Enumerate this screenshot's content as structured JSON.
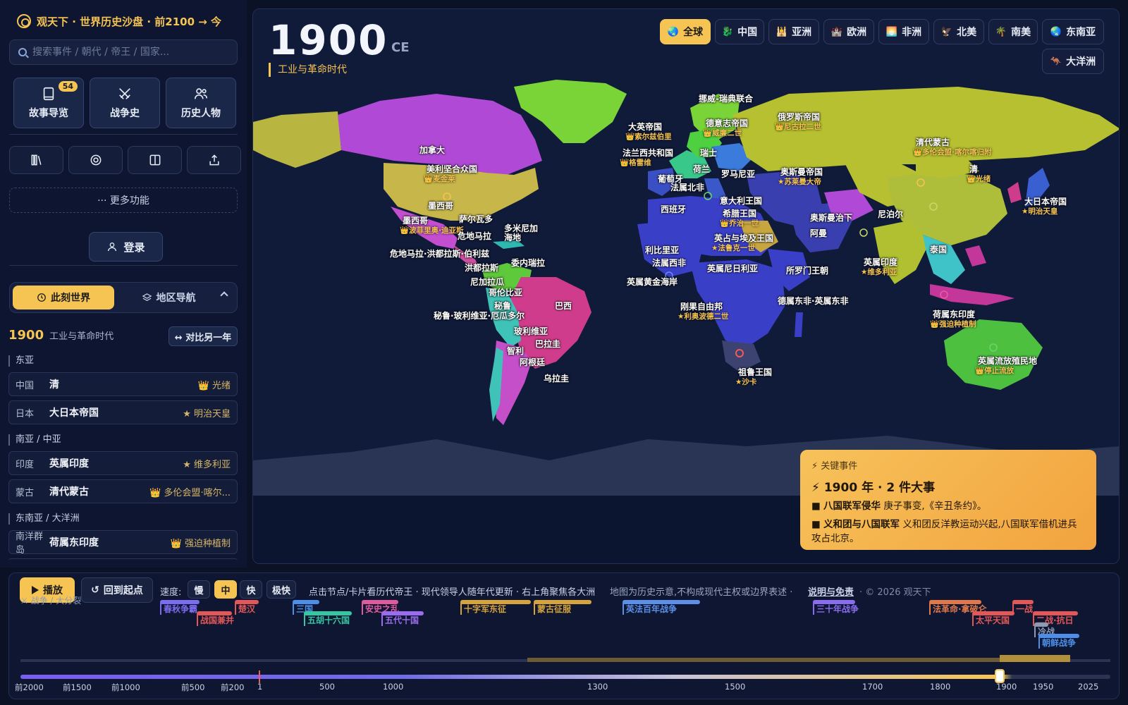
{
  "app": {
    "title": "观天下 · 世界历史沙盘 · 前2100 → 今",
    "search_placeholder": "搜索事件 / 朝代 / 帝王 / 国家..."
  },
  "nav": {
    "stories_label": "故事导览",
    "stories_badge": "54",
    "wars_label": "战争史",
    "people_label": "历史人物",
    "more_label": "··· 更多功能",
    "login_label": "登录"
  },
  "mode": {
    "now_label": "此刻世界",
    "region_label": "地区导航"
  },
  "current": {
    "year": "1900",
    "era": "工业与革命时代",
    "compare_label": "↔ 对比另一年",
    "big_year": "1900",
    "ce": "CE"
  },
  "regions_panel": [
    {
      "head": "东亚",
      "rows": [
        {
          "country": "中国",
          "state": "清",
          "ruler": "👑 光绪"
        },
        {
          "country": "日本",
          "state": "大日本帝国",
          "ruler": "★ 明治天皇"
        }
      ]
    },
    {
      "head": "南亚 / 中亚",
      "rows": [
        {
          "country": "印度",
          "state": "英属印度",
          "ruler": "★ 维多利亚"
        },
        {
          "country": "蒙古",
          "state": "清代蒙古",
          "ruler": "👑 多伦会盟·喀尔..."
        }
      ]
    },
    {
      "head": "东南亚 / 大洋洲",
      "rows": [
        {
          "country": "南洋群岛",
          "state": "荷属东印度",
          "ruler": "👑 强迫种植制"
        }
      ]
    }
  ],
  "region_buttons": [
    {
      "icon": "🌏",
      "label": "全球",
      "active": true
    },
    {
      "icon": "🐉",
      "label": "中国"
    },
    {
      "icon": "🕌",
      "label": "亚洲"
    },
    {
      "icon": "🏰",
      "label": "欧洲"
    },
    {
      "icon": "🌅",
      "label": "非洲"
    },
    {
      "icon": "🦅",
      "label": "北美"
    },
    {
      "icon": "🌴",
      "label": "南美"
    },
    {
      "icon": "🌏",
      "label": "东南亚"
    },
    {
      "icon": "🦘",
      "label": "大洋洲"
    }
  ],
  "map_labels": [
    {
      "t": "挪威-瑞典联合"
    },
    {
      "t": "大英帝国",
      "s": "👑索尔兹伯里"
    },
    {
      "t": "德意志帝国",
      "s": "👑威廉二世"
    },
    {
      "t": "俄罗斯帝国",
      "s": "👑尼古拉二世"
    },
    {
      "t": "清代蒙古",
      "s": "👑多伦会盟·喀尔喀归附"
    },
    {
      "t": "加拿大"
    },
    {
      "t": "法兰西共和国",
      "s": "👑格雷维"
    },
    {
      "t": "瑞士"
    },
    {
      "t": "荷兰"
    },
    {
      "t": "清",
      "s": "👑光绪"
    },
    {
      "t": "美利坚合众国",
      "s": "👑麦金莱"
    },
    {
      "t": "葡萄牙"
    },
    {
      "t": "罗马尼亚"
    },
    {
      "t": "奥斯曼帝国",
      "s": "★苏莱曼大帝"
    },
    {
      "t": "法属北非"
    },
    {
      "t": "意大利王国"
    },
    {
      "t": "大日本帝国",
      "s": "★明治天皇"
    },
    {
      "t": "墨西哥"
    },
    {
      "t": "西班牙"
    },
    {
      "t": "希腊王国",
      "s": "👑乔治一世"
    },
    {
      "t": "尼泊尔"
    },
    {
      "t": "奥斯曼治下"
    },
    {
      "t": "墨西哥",
      "s": "👑波菲里奥·迪亚斯"
    },
    {
      "t": "萨尔瓦多"
    },
    {
      "t": "多米尼加"
    },
    {
      "t": "海地"
    },
    {
      "t": "阿曼"
    },
    {
      "t": "危地马拉"
    },
    {
      "t": "英占与埃及王国",
      "s": "★法鲁克一世"
    },
    {
      "t": "利比里亚"
    },
    {
      "t": "泰国"
    },
    {
      "t": "危地马拉·洪都拉斯·伯利兹"
    },
    {
      "t": "英属印度",
      "s": "★维多利亚"
    },
    {
      "t": "委内瑞拉"
    },
    {
      "t": "法属西非"
    },
    {
      "t": "英属尼日利亚"
    },
    {
      "t": "所罗门王朝"
    },
    {
      "t": "洪都拉斯"
    },
    {
      "t": "尼加拉瓜"
    },
    {
      "t": "英属黄金海岸"
    },
    {
      "t": "哥伦比亚"
    },
    {
      "t": "德属东非·英属东非"
    },
    {
      "t": "秘鲁"
    },
    {
      "t": "巴西"
    },
    {
      "t": "刚果自由邦",
      "s": "★利奥波德二世"
    },
    {
      "t": "荷属东印度",
      "s": "👑强迫种植制"
    },
    {
      "t": "秘鲁·玻利维亚·厄瓜多尔"
    },
    {
      "t": "玻利维亚"
    },
    {
      "t": "巴拉圭"
    },
    {
      "t": "智利"
    },
    {
      "t": "阿根廷"
    },
    {
      "t": "英属流放殖民地",
      "s": "👑停止流放"
    },
    {
      "t": "祖鲁王国",
      "s": "★沙卡"
    },
    {
      "t": "乌拉圭"
    }
  ],
  "event_card": {
    "kicker": "⚡ 关键事件",
    "title": "⚡ 1900 年 · 2 件大事",
    "items": [
      {
        "name": "八国联军侵华",
        "desc": "庚子事变,《辛丑条约》。"
      },
      {
        "name": "义和团与八国联军",
        "desc": "义和团反洋教运动兴起,八国联军借机进兵攻占北京。"
      }
    ]
  },
  "timeline": {
    "play_label": "播放",
    "reset_label": "回到起点",
    "speed_label": "速度:",
    "speeds": [
      "慢",
      "中",
      "快",
      "极快"
    ],
    "active_speed": "中",
    "tip": "点击节点/卡片看历代帝王 · 现代领导人随年代更新 · 右上角聚焦各大洲",
    "disclaimer": "地图为历史示意,不构成现代主权或边界表述 ·",
    "link": "说明与免责",
    "copyright": "· © 2026 观天下",
    "legend": "⚔ 战争 / 大分裂",
    "events": [
      {
        "label": "春秋争霸",
        "color": "#7c6cf0"
      },
      {
        "label": "战国兼并",
        "color": "#e45757"
      },
      {
        "label": "楚汉",
        "color": "#e45757"
      },
      {
        "label": "三国",
        "color": "#4d8fe8"
      },
      {
        "label": "五胡十六国",
        "color": "#35c7a2"
      },
      {
        "label": "安史之乱",
        "color": "#e05a9e"
      },
      {
        "label": "五代十国",
        "color": "#9b6cf0"
      },
      {
        "label": "十字军东征",
        "color": "#d6a43a"
      },
      {
        "label": "蒙古征服",
        "color": "#d6a43a"
      },
      {
        "label": "英法百年战争",
        "color": "#5b8fe8"
      },
      {
        "label": "三十年战争",
        "color": "#8a6cf0"
      },
      {
        "label": "法革命·拿破仑",
        "color": "#e0784a"
      },
      {
        "label": "太平天国",
        "color": "#e45757"
      },
      {
        "label": "一战",
        "color": "#e45757"
      },
      {
        "label": "二战·抗日",
        "color": "#e45757"
      },
      {
        "label": "冷战",
        "color": "#8f9ab3"
      },
      {
        "label": "朝鲜战争",
        "color": "#4d8fe8"
      }
    ],
    "ticks": [
      "前2000",
      "前1500",
      "前1000",
      "前500",
      "前200",
      "1",
      "500",
      "1000",
      "1300",
      "1500",
      "1700",
      "1800",
      "1900",
      "1950",
      "2025"
    ]
  },
  "colors": {
    "accent": "#f6c453",
    "ocean": "#101a39"
  }
}
